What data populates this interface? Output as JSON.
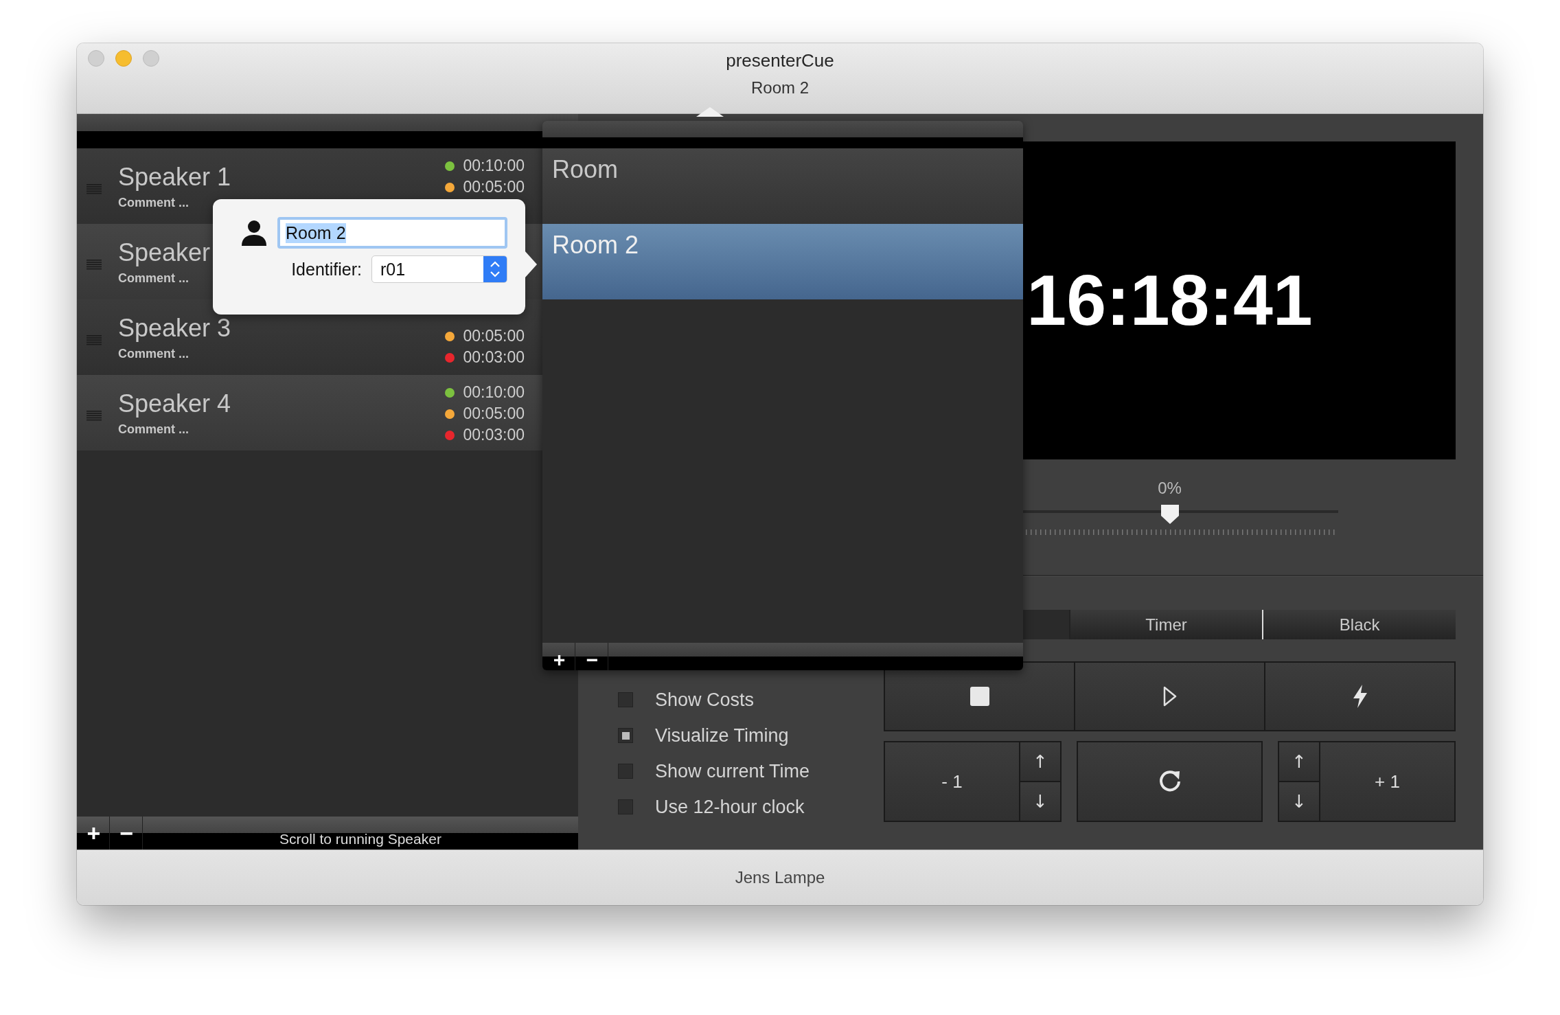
{
  "window": {
    "title": "presenterCue",
    "subtitle": "Room 2"
  },
  "speakers": [
    {
      "name": "Speaker 1",
      "comment": "Comment ...",
      "times": [
        {
          "text": "00:10:00",
          "color": "#7cc13f"
        },
        {
          "text": "00:05:00",
          "color": "#f5a83a"
        }
      ]
    },
    {
      "name": "Speaker",
      "comment": "Comment ..."
    },
    {
      "name": "Speaker 3",
      "comment": "Comment ...",
      "times": [
        {
          "text": "00:05:00",
          "color": "#f5a83a"
        },
        {
          "text": "00:03:00",
          "color": "#e8262d"
        }
      ]
    },
    {
      "name": "Speaker 4",
      "comment": "Comment ...",
      "times": [
        {
          "text": "00:10:00",
          "color": "#7cc13f"
        },
        {
          "text": "00:05:00",
          "color": "#f5a83a"
        },
        {
          "text": "00:03:00",
          "color": "#e8262d"
        }
      ]
    }
  ],
  "speaker_toolbar": {
    "add": "+",
    "remove": "−",
    "scroll_button": "Scroll to running Speaker"
  },
  "preview": {
    "clock": "16:18:41"
  },
  "slider": {
    "reading": "0%",
    "level": 0.5
  },
  "tabs": [
    {
      "label": "Timer",
      "selected": false
    },
    {
      "label": "Black",
      "selected": false
    }
  ],
  "options": [
    {
      "label": "Show Costs",
      "checked": false
    },
    {
      "label": "Visualize Timing",
      "checked": true
    },
    {
      "label": "Show current Time",
      "checked": false
    },
    {
      "label": "Use 12-hour clock",
      "checked": false
    }
  ],
  "adjust": {
    "minus": "- 1",
    "plus": "+ 1",
    "up": "↑",
    "down": "↓"
  },
  "rooms_popup": {
    "rooms": [
      {
        "name": "Room",
        "selected": false
      },
      {
        "name": "Room 2",
        "selected": true
      }
    ],
    "add": "+",
    "remove": "−"
  },
  "room_editor": {
    "name_value": "Room 2",
    "value_selected": true,
    "identifier_label": "Identifier:",
    "identifier_value": "r01"
  },
  "status_bar": {
    "text": "Jens Lampe"
  }
}
